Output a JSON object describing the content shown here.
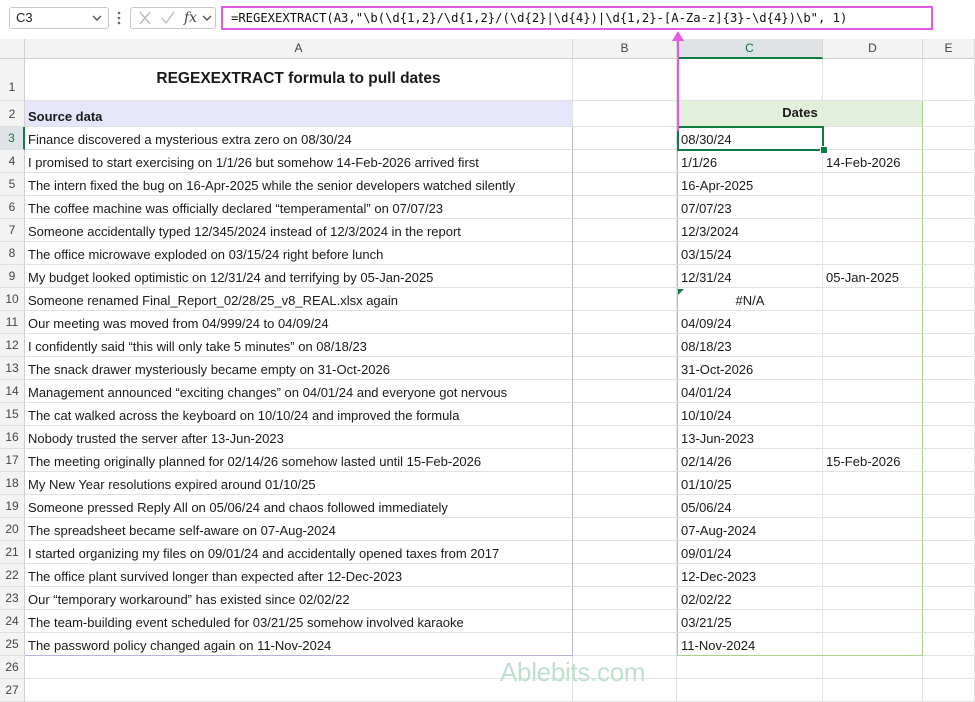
{
  "formula_bar": {
    "name_box": "C3",
    "formula": "=REGEXEXTRACT(A3,\"\\b(\\d{1,2}/\\d{1,2}/(\\d{2}|\\d{4})|\\d{1,2}-[A-Za-z]{3}-\\d{4})\\b\", 1)"
  },
  "columns": [
    "A",
    "B",
    "C",
    "D",
    "E"
  ],
  "rows": [
    "1",
    "2",
    "3",
    "4",
    "5",
    "6",
    "7",
    "8",
    "9",
    "10",
    "11",
    "12",
    "13",
    "14",
    "15",
    "16",
    "17",
    "18",
    "19",
    "20",
    "21",
    "22",
    "23",
    "24",
    "25",
    "26",
    "27"
  ],
  "sheet": {
    "title": "REGEXEXTRACT formula to pull dates",
    "source_header": "Source data",
    "dates_header": "Dates",
    "data": [
      {
        "a": "Finance discovered a mysterious extra zero on 08/30/24",
        "c": "08/30/24",
        "d": ""
      },
      {
        "a": "I promised to start exercising on 1/1/26 but somehow 14-Feb-2026 arrived first",
        "c": "1/1/26",
        "d": "14-Feb-2026"
      },
      {
        "a": "The intern fixed the bug on 16-Apr-2025 while the senior developers watched silently",
        "c": "16-Apr-2025",
        "d": ""
      },
      {
        "a": "The coffee machine was officially declared “temperamental” on 07/07/23",
        "c": "07/07/23",
        "d": ""
      },
      {
        "a": "Someone accidentally typed 12/345/2024 instead of 12/3/2024 in the report",
        "c": "12/3/2024",
        "d": ""
      },
      {
        "a": "The office microwave exploded on 03/15/24 right before lunch",
        "c": "03/15/24",
        "d": ""
      },
      {
        "a": "My budget looked optimistic on 12/31/24 and terrifying by 05-Jan-2025",
        "c": "12/31/24",
        "d": "05-Jan-2025"
      },
      {
        "a": "Someone renamed Final_Report_02/28/25_v8_REAL.xlsx again",
        "c": "#N/A",
        "d": ""
      },
      {
        "a": "Our meeting was moved from 04/999/24 to 04/09/24",
        "c": "04/09/24",
        "d": ""
      },
      {
        "a": "I confidently said “this will only take 5 minutes” on 08/18/23",
        "c": "08/18/23",
        "d": ""
      },
      {
        "a": "The snack drawer mysteriously became empty on 31-Oct-2026",
        "c": "31-Oct-2026",
        "d": ""
      },
      {
        "a": "Management announced “exciting changes” on 04/01/24 and everyone got nervous",
        "c": "04/01/24",
        "d": ""
      },
      {
        "a": "The cat walked across the keyboard on 10/10/24 and improved the formula",
        "c": "10/10/24",
        "d": ""
      },
      {
        "a": "Nobody trusted the server after 13-Jun-2023",
        "c": "13-Jun-2023",
        "d": ""
      },
      {
        "a": "The meeting originally planned for 02/14/26 somehow lasted until 15-Feb-2026",
        "c": "02/14/26",
        "d": "15-Feb-2026"
      },
      {
        "a": "My New Year resolutions expired around 01/10/25",
        "c": "01/10/25",
        "d": ""
      },
      {
        "a": "Someone pressed Reply All on 05/06/24 and chaos followed immediately",
        "c": "05/06/24",
        "d": ""
      },
      {
        "a": "The spreadsheet became self-aware on 07-Aug-2024",
        "c": "07-Aug-2024",
        "d": ""
      },
      {
        "a": "I started organizing my files on 09/01/24 and accidentally opened taxes from 2017",
        "c": "09/01/24",
        "d": ""
      },
      {
        "a": "The office plant survived longer than expected after 12-Dec-2023",
        "c": "12-Dec-2023",
        "d": ""
      },
      {
        "a": "Our “temporary workaround” has existed since 02/02/22",
        "c": "02/02/22",
        "d": ""
      },
      {
        "a": "The team-building event scheduled for 03/21/25 somehow involved karaoke",
        "c": "03/21/25",
        "d": ""
      },
      {
        "a": "The password policy changed again on 11-Nov-2024",
        "c": "11-Nov-2024",
        "d": ""
      }
    ]
  },
  "icons": {
    "name_box_dropdown": "chevron-down-icon",
    "options": "vertical-dots-icon",
    "cancel": "close-icon",
    "enter": "check-icon",
    "function": "fx-icon",
    "formula_dropdown": "chevron-down-icon"
  },
  "function_label": "fx",
  "watermark": "Ablebits.com",
  "colors": {
    "accent": "#107c41",
    "highlight_border": "#e45ae4",
    "source_header_bg": "#e6e6fa",
    "dates_header_bg": "#e2efda"
  }
}
